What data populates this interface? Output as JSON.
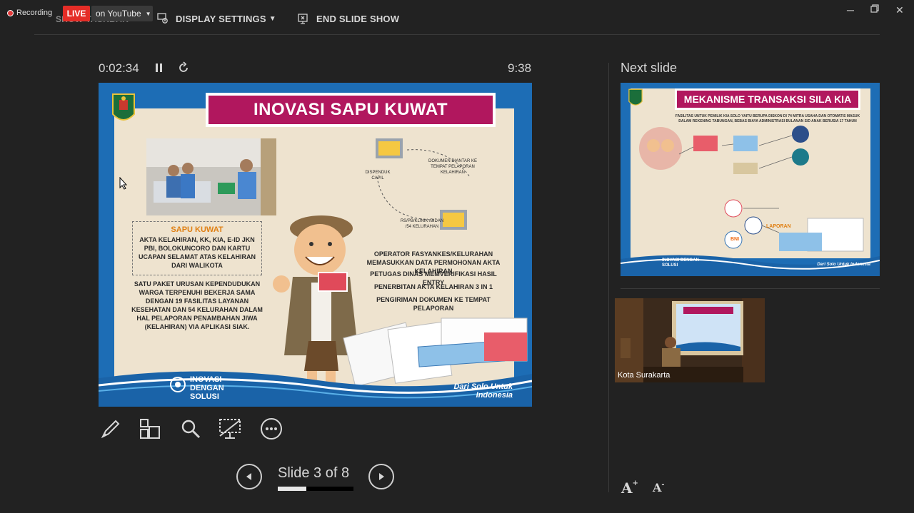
{
  "topbar": {
    "recording_label": "Recording",
    "taskbar_ghost": "SHOW TASKBAR",
    "live_label": "LIVE",
    "stream_target": "on YouTube",
    "display_settings_label": "DISPLAY SETTINGS",
    "end_show_label": "END SLIDE SHOW"
  },
  "presenter": {
    "elapsed_time": "0:02:34",
    "clock_time": "9:38",
    "next_slide_label": "Next slide",
    "slide_counter": "Slide 3 of 8",
    "progress_fraction": 0.375
  },
  "current_slide": {
    "title": "INOVASI SAPU KUWAT",
    "box_heading": "SAPU KUWAT",
    "box_text": "AKTA KELAHIRAN, KK, KIA, E-ID JKN PBI, BOLOKUNCORO DAN KARTU UCAPAN SELAMAT ATAS KELAHIRAN DARI WALIKOTA",
    "paket_text": "SATU PAKET URUSAN KEPENDUDUKAN WARGA TERPENUHI BEKERJA SAMA DENGAN 19 FASILITAS LAYANAN KESEHATAN DAN 54 KELURAHAN DALAM HAL PELAPORAN PENAMBAHAN JIWA (KELAHIRAN) VIA APLIKASI SIAK.",
    "flow_label_1": "DOKUMEN DIANTAR KE TEMPAT PELAPORAN KELAHIRAN",
    "flow_label_2": "DISPENDUK CAPIL",
    "flow_label_3": "RS/PB/KLINIK /BIDAN /54 KELURAHAN",
    "steps": [
      "OPERATOR FASYANKES/KELURAHAN MEMASUKKAN DATA PERMOHONAN AKTA KELAHIRAN",
      "PETUGAS DINAS MEMVERIFIKASI HASIL ENTRY",
      "PENERBITAN AKTA KELAHIRAN 3 IN 1",
      "PENGIRIMAN DOKUMEN KE TEMPAT PELAPORAN"
    ],
    "footer_left": "INOVASI DENGAN SOLUSI",
    "footer_right": "Dari Solo Untuk Indonesia"
  },
  "next_slide": {
    "title": "MEKANISME TRANSAKSI SILA KIA",
    "intro": "FASILITAS UNTUK PEMILIK KIA SOLO YAITU BERUPA DISKON DI 74 MITRA USAHA DAN OTOMATIS MASUK DALAM REKENING TABUNGAN, BEBAS BIAYA ADMINISTRASI BULANAN S/D ANAK BERUSIA 17 TAHUN",
    "laporan": "LAPORAN",
    "bank": "BNI",
    "footer_left": "INOVASI DENGAN SOLUSI",
    "footer_right": "Dari Solo Untuk Indonesia"
  },
  "video": {
    "participant_name": "Kota Surakarta"
  },
  "colors": {
    "background": "#222222",
    "live_red": "#e52d27",
    "slide_blue": "#1d6db5",
    "title_magenta": "#b1175e",
    "slide_cream": "#eee3cf"
  }
}
